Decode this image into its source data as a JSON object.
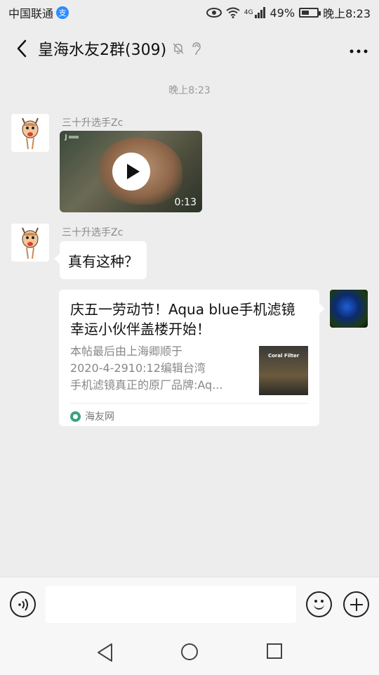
{
  "status_bar": {
    "carrier": "中国联通",
    "carrier_badge": "支",
    "network": "4G",
    "battery": "49%",
    "time": "晚上8:23"
  },
  "header": {
    "title": "皇海水友2群(309)",
    "icons": [
      "back-icon",
      "mute-bell-icon",
      "ear-icon",
      "more-icon"
    ]
  },
  "messages": {
    "time_label": "晚上8:23",
    "video": {
      "sender": "三十升选手Zc",
      "duration": "0:13"
    },
    "text": {
      "sender": "三十升选手Zc",
      "content": "真有这种？"
    },
    "link_card": {
      "title": "庆五一劳动节！Aqua blue手机滤镜幸运小伙伴盖楼开始！",
      "description": "本帖最后由上海卿顺于\n2020-4-2910:12编辑台湾\n手机滤镜真正的原厂品牌:Aq...",
      "thumb_label": "Coral Filter",
      "source": "海友网"
    }
  },
  "input_bar": {
    "placeholder": ""
  },
  "colors": {
    "background": "#ededed",
    "bubble": "#ffffff",
    "meta_text": "#8a8a8a"
  }
}
